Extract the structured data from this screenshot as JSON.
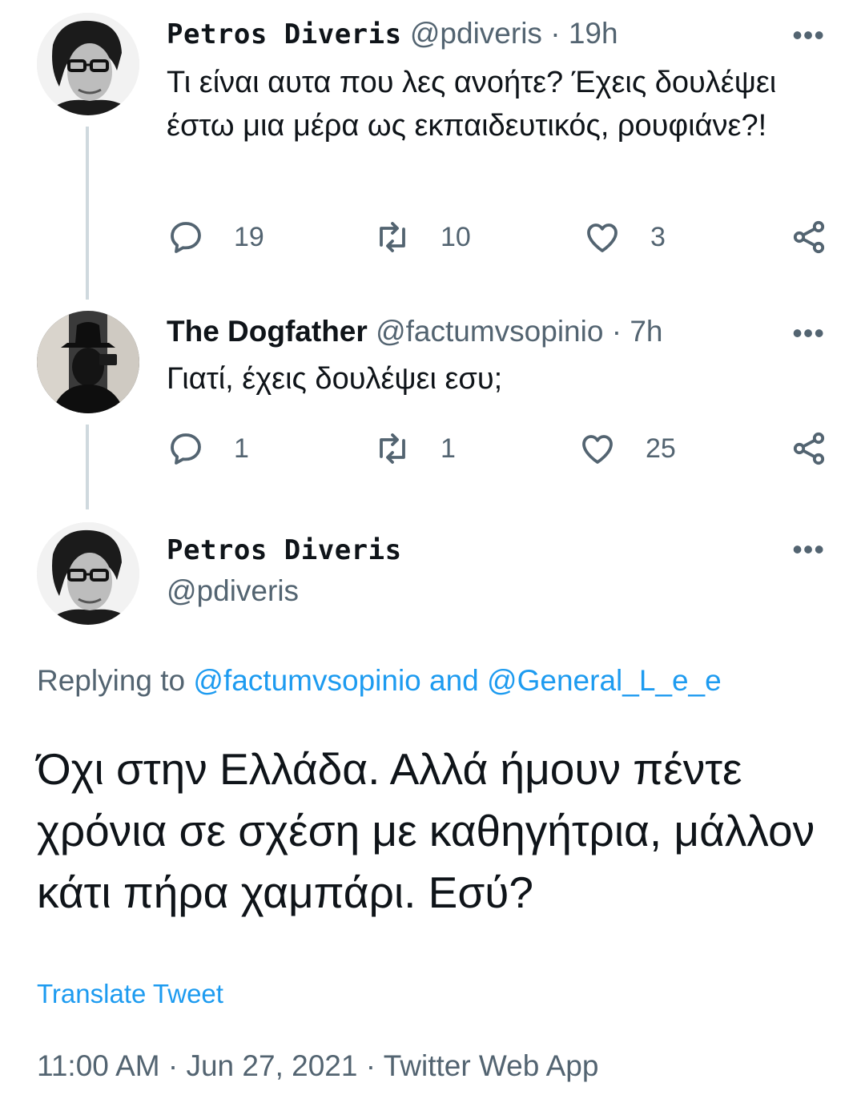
{
  "colors": {
    "accent": "#1d9bf0",
    "muted": "#536471",
    "text": "#0f1419",
    "thread_line": "#cfd9de"
  },
  "tweets": [
    {
      "name": "Petros Diveris",
      "handle": "@pdiveris",
      "sep": "·",
      "time": "19h",
      "more": "•••",
      "text": "Τι είναι αυτα που λες ανοήτε? Έχεις δουλέψει έστω μια μέρα ως εκπαιδευτικός, ρουφιάνε?!",
      "avatar_icon": "avatar-photo-man-glasses",
      "actions": {
        "replies": "19",
        "retweets": "10",
        "likes": "3"
      }
    },
    {
      "name": "The Dogfather",
      "handle": "@factumvsopinio",
      "sep": "·",
      "time": "7h",
      "more": "•••",
      "text": "Γιατί, έχεις δουλέψει εσυ;",
      "avatar_icon": "avatar-photo-silhouette-hat",
      "actions": {
        "replies": "1",
        "retweets": "1",
        "likes": "25"
      }
    }
  ],
  "main": {
    "name": "Petros Diveris",
    "handle": "@pdiveris",
    "more": "•••",
    "replying_prefix": "Replying to",
    "replying_user1": "@factumvsopinio",
    "replying_and": "and",
    "replying_user2": "@General_L_e_e",
    "text": "Όχι στην Ελλάδα. Αλλά ήμουν πέντε χρόνια σε σχέση με καθηγήτρια, μάλλον κάτι πήρα χαμπάρι. Εσύ?",
    "translate": "Translate Tweet",
    "time": "11:00 AM",
    "sep": "·",
    "date": "Jun 27, 2021",
    "source": "Twitter Web App"
  },
  "icons": [
    "reply-icon",
    "retweet-icon",
    "like-icon",
    "share-icon",
    "more-icon"
  ]
}
